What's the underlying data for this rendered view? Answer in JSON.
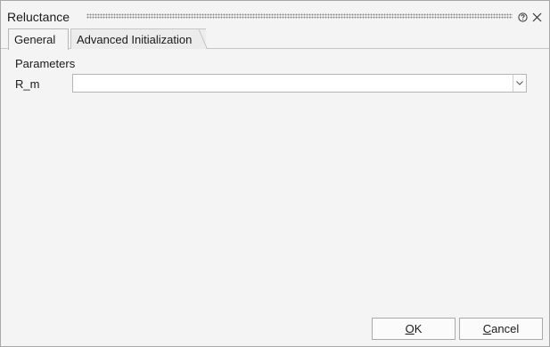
{
  "window": {
    "title": "Reluctance"
  },
  "tabs": [
    {
      "label": "General",
      "selected": true
    },
    {
      "label": "Advanced Initialization",
      "selected": false
    }
  ],
  "general": {
    "group_label": "Parameters",
    "fields": [
      {
        "label": "R_m",
        "value": ""
      }
    ]
  },
  "buttons": {
    "ok": {
      "accel": "O",
      "rest": "K"
    },
    "cancel": {
      "accel": "C",
      "rest": "ancel"
    }
  },
  "icons": {
    "help": "help-icon",
    "close": "close-icon",
    "dropdown": "chevron-down-icon"
  },
  "colors": {
    "dialog_bg": "#f4f4f4",
    "border": "#a8a8a8",
    "text": "#1a1a1a"
  }
}
